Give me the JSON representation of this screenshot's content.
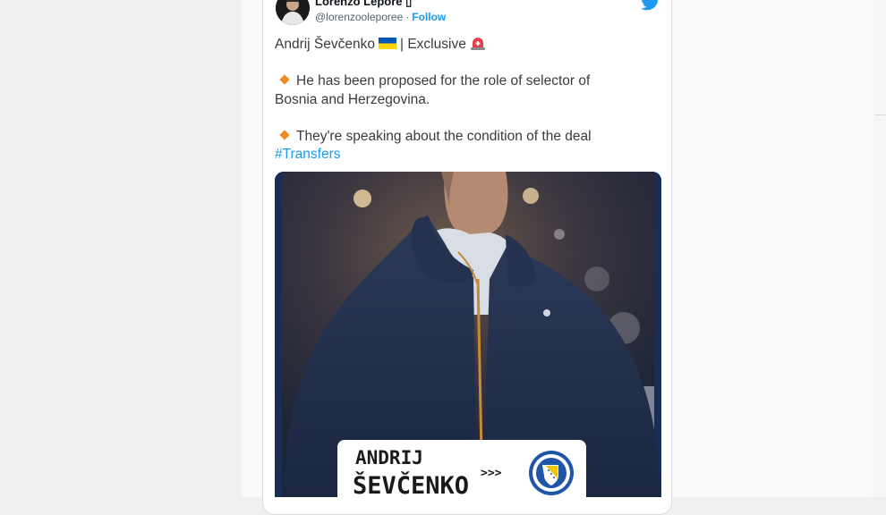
{
  "tweet": {
    "author_name": "Lorenzo Lepore",
    "verified_glyph": "▯",
    "handle": "@lorenzooleporee",
    "separator": "·",
    "follow_label": "Follow",
    "text": {
      "title": "Andrij Ševčenko",
      "title_suffix": "| Exclusive",
      "point_1_line_1": "He has been proposed for the role of  selector of",
      "point_1_line_2": "Bosnia and Herzegovina.",
      "point_2": "They're speaking about the condition of the deal",
      "hashtag": "#Transfers"
    },
    "icons": {
      "platform": "twitter-bird-icon",
      "flag": "ukraine-flag-icon",
      "siren": "rotating-light-icon",
      "bullet": "orange-diamond-icon"
    }
  },
  "media": {
    "plate_first_name": "ANDRIJ",
    "plate_last_name": "ŠEVČENKO",
    "plate_arrows": ">>>",
    "crest": "bosnia-herzegovina-football-federation-crest"
  },
  "colors": {
    "link": "#1d9bf0",
    "bullet": "#f18a1f",
    "frame_blue": "#1a2d55",
    "flag_blue": "#0057b7",
    "flag_yellow": "#ffd700"
  }
}
